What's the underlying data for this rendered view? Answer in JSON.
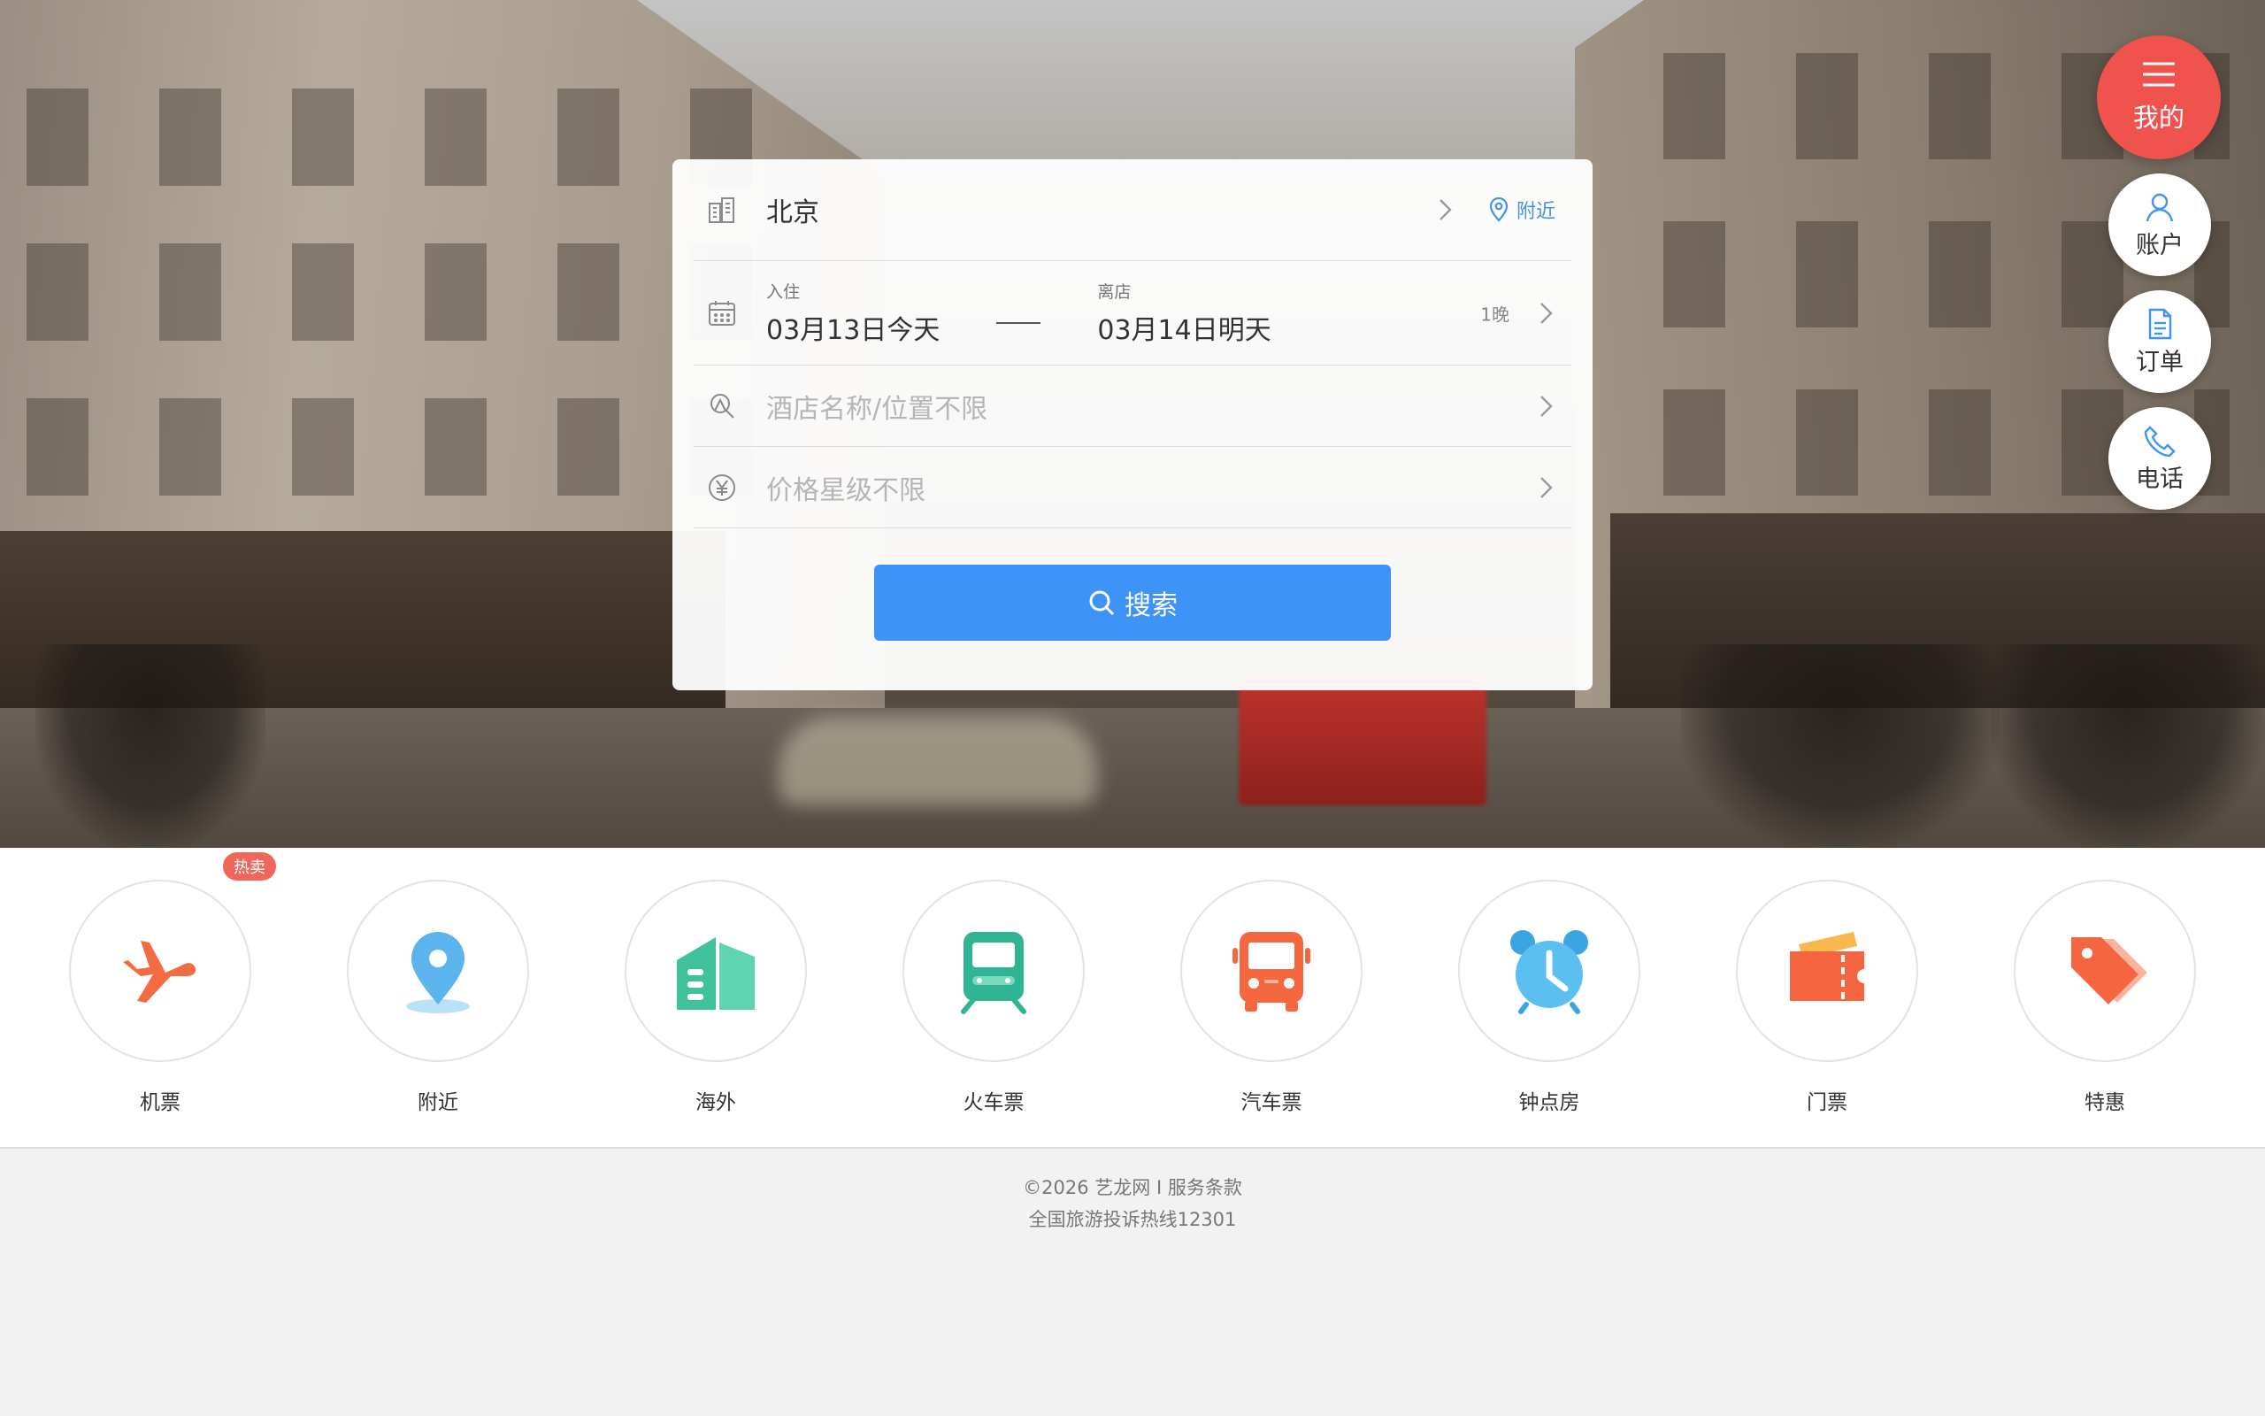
{
  "search": {
    "city": "北京",
    "nearby_label": "附近",
    "checkin_label": "入住",
    "checkin_value": "03月13日今天",
    "checkout_label": "离店",
    "checkout_value": "03月14日明天",
    "nights": "1晚",
    "hotel_placeholder": "酒店名称/位置不限",
    "price_placeholder": "价格星级不限",
    "search_button": "搜索"
  },
  "side_menu": {
    "main_label": "我的",
    "account_label": "账户",
    "orders_label": "订单",
    "phone_label": "电话"
  },
  "categories": [
    {
      "label": "机票",
      "icon": "plane-icon",
      "badge": "热卖"
    },
    {
      "label": "附近",
      "icon": "location-pin-icon"
    },
    {
      "label": "海外",
      "icon": "buildings-icon"
    },
    {
      "label": "火车票",
      "icon": "train-icon"
    },
    {
      "label": "汽车票",
      "icon": "bus-icon"
    },
    {
      "label": "钟点房",
      "icon": "alarm-clock-icon"
    },
    {
      "label": "门票",
      "icon": "ticket-icon"
    },
    {
      "label": "特惠",
      "icon": "price-tag-icon"
    }
  ],
  "footer": {
    "line1": "©2026 艺龙网 I 服务条款",
    "line2": "全国旅游投诉热线12301"
  },
  "colors": {
    "primary_blue": "#3d94f6",
    "menu_red": "#f0524e",
    "plane_orange": "#f26b43",
    "pin_blue": "#5bb4ec",
    "building_green": "#3fc19c",
    "train_green": "#2fb593",
    "bus_orange": "#f5673f",
    "clock_blue": "#5bc0f0",
    "ticket_orange": "#f5653f",
    "tag_orange": "#f5653f"
  }
}
